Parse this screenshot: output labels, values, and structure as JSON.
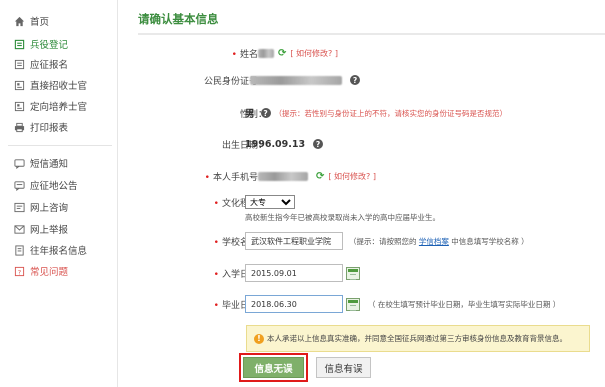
{
  "sidebar": {
    "items": [
      {
        "label": "首页",
        "icon": "home-icon"
      },
      {
        "label": "兵役登记",
        "icon": "register-icon"
      },
      {
        "label": "应征报名",
        "icon": "form-icon"
      },
      {
        "label": "直接招收士官",
        "icon": "doc-icon"
      },
      {
        "label": "定向培养士官",
        "icon": "doc-icon"
      },
      {
        "label": "打印报表",
        "icon": "print-icon"
      },
      {
        "label": "短信通知",
        "icon": "message-icon"
      },
      {
        "label": "应征地公告",
        "icon": "notice-icon"
      },
      {
        "label": "网上咨询",
        "icon": "consult-icon"
      },
      {
        "label": "网上举报",
        "icon": "report-icon"
      },
      {
        "label": "往年报名信息",
        "icon": "history-icon"
      },
      {
        "label": "常见问题",
        "icon": "question-icon"
      }
    ]
  },
  "main": {
    "title": "请确认基本信息",
    "fields": {
      "name_label": "姓名：",
      "modify_link": "[ 如何修改? ]",
      "id_label": "公民身份证号：",
      "gender_label": "性别：",
      "gender_value": "男",
      "gender_hint": "（提示：若性别与身份证上的不符，请核实您的身份证号码是否规范）",
      "birth_label": "出生日期：",
      "birth_value": "1996.09.13",
      "phone_label": "本人手机号：",
      "phone_modify_link": "[ 如何修改? ]",
      "edu_label": "文化程度：",
      "edu_value": "大专",
      "edu_hint": "高校新生指今年已被高校录取尚未入学的高中应届毕业生。",
      "school_label": "学校名称：",
      "school_value": "武汉软件工程职业学院",
      "school_hint_pre": "（提示：请按照您的 ",
      "school_hint_link": "学信档案",
      "school_hint_post": " 中信息填写学校名称 ）",
      "enroll_label": "入学日期：",
      "enroll_value": "2015.09.01",
      "grad_label": "毕业日期：",
      "grad_value": "2018.06.30",
      "grad_hint": "（ 在校生填写预计毕业日期，毕业生填写实际毕业日期 ）"
    },
    "notice": "本人承诺以上信息真实准确，并同意全国征兵网通过第三方审核身份信息及教育背景信息。",
    "buttons": {
      "confirm": "信息无误",
      "error": "信息有误"
    }
  },
  "colors": {
    "accent_green": "#3c8d3f",
    "required_red": "#e02020",
    "hint_red": "#d9534f",
    "highlight_red": "#e01a1a"
  }
}
